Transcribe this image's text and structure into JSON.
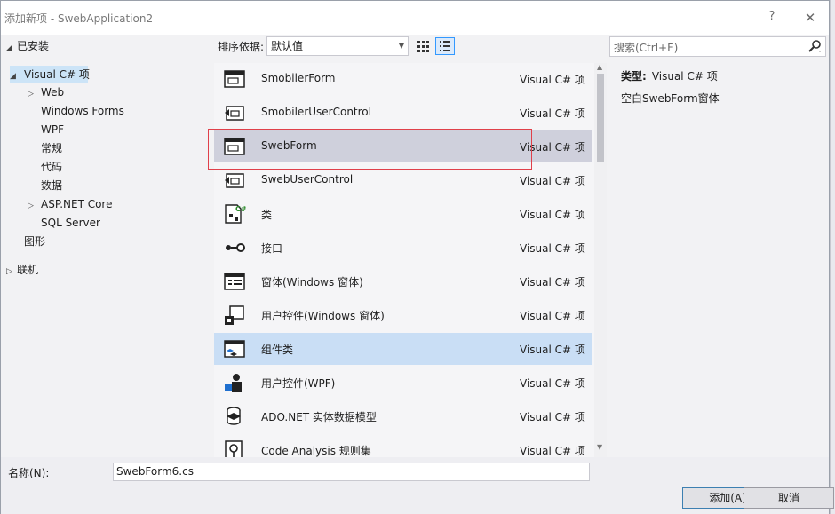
{
  "window": {
    "title": "添加新项 - SwebApplication2",
    "help_glyph": "?",
    "close_glyph": "✕"
  },
  "tree": {
    "installed": "已安装",
    "visual_csharp": "Visual C# 项",
    "web": "Web",
    "windows_forms": "Windows Forms",
    "wpf": "WPF",
    "general": "常规",
    "code": "代码",
    "data": "数据",
    "aspnet_core": "ASP.NET Core",
    "sql_server": "SQL Server",
    "graphics": "图形",
    "online": "联机"
  },
  "toolbar": {
    "sort_label": "排序依据:",
    "sort_value": "默认值",
    "search_placeholder": "搜索(Ctrl+E)"
  },
  "templates": [
    {
      "name": "SmobilerForm",
      "lang": "Visual C# 项",
      "icon": "form-window-icon"
    },
    {
      "name": "SmobilerUserControl",
      "lang": "Visual C# 项",
      "icon": "user-control-icon"
    },
    {
      "name": "SwebForm",
      "lang": "Visual C# 项",
      "icon": "form-window-icon"
    },
    {
      "name": "SwebUserControl",
      "lang": "Visual C# 项",
      "icon": "user-control-icon"
    },
    {
      "name": "类",
      "lang": "Visual C# 项",
      "icon": "csharp-class-icon"
    },
    {
      "name": "接口",
      "lang": "Visual C# 项",
      "icon": "interface-icon"
    },
    {
      "name": "窗体(Windows 窗体)",
      "lang": "Visual C# 项",
      "icon": "windows-form-icon"
    },
    {
      "name": "用户控件(Windows 窗体)",
      "lang": "Visual C# 项",
      "icon": "winforms-user-control-icon"
    },
    {
      "name": "组件类",
      "lang": "Visual C# 项",
      "icon": "component-class-icon"
    },
    {
      "name": "用户控件(WPF)",
      "lang": "Visual C# 项",
      "icon": "wpf-user-control-icon"
    },
    {
      "name": "ADO.NET 实体数据模型",
      "lang": "Visual C# 项",
      "icon": "entity-model-icon"
    },
    {
      "name": "Code Analysis 规则集",
      "lang": "Visual C# 项",
      "icon": "rule-set-icon"
    }
  ],
  "details": {
    "type_label": "类型:",
    "type_value": "Visual C# 项",
    "description": "空白SwebForm窗体"
  },
  "bottom": {
    "name_label": "名称(N):",
    "name_value": "SwebForm6.cs",
    "add_label": "添加(A)",
    "cancel_label": "取消"
  },
  "colors": {
    "selected_row": "#cfd0dc",
    "hover_row": "#c9def5",
    "highlight_box": "#e0404a",
    "accent": "#3399ff"
  }
}
